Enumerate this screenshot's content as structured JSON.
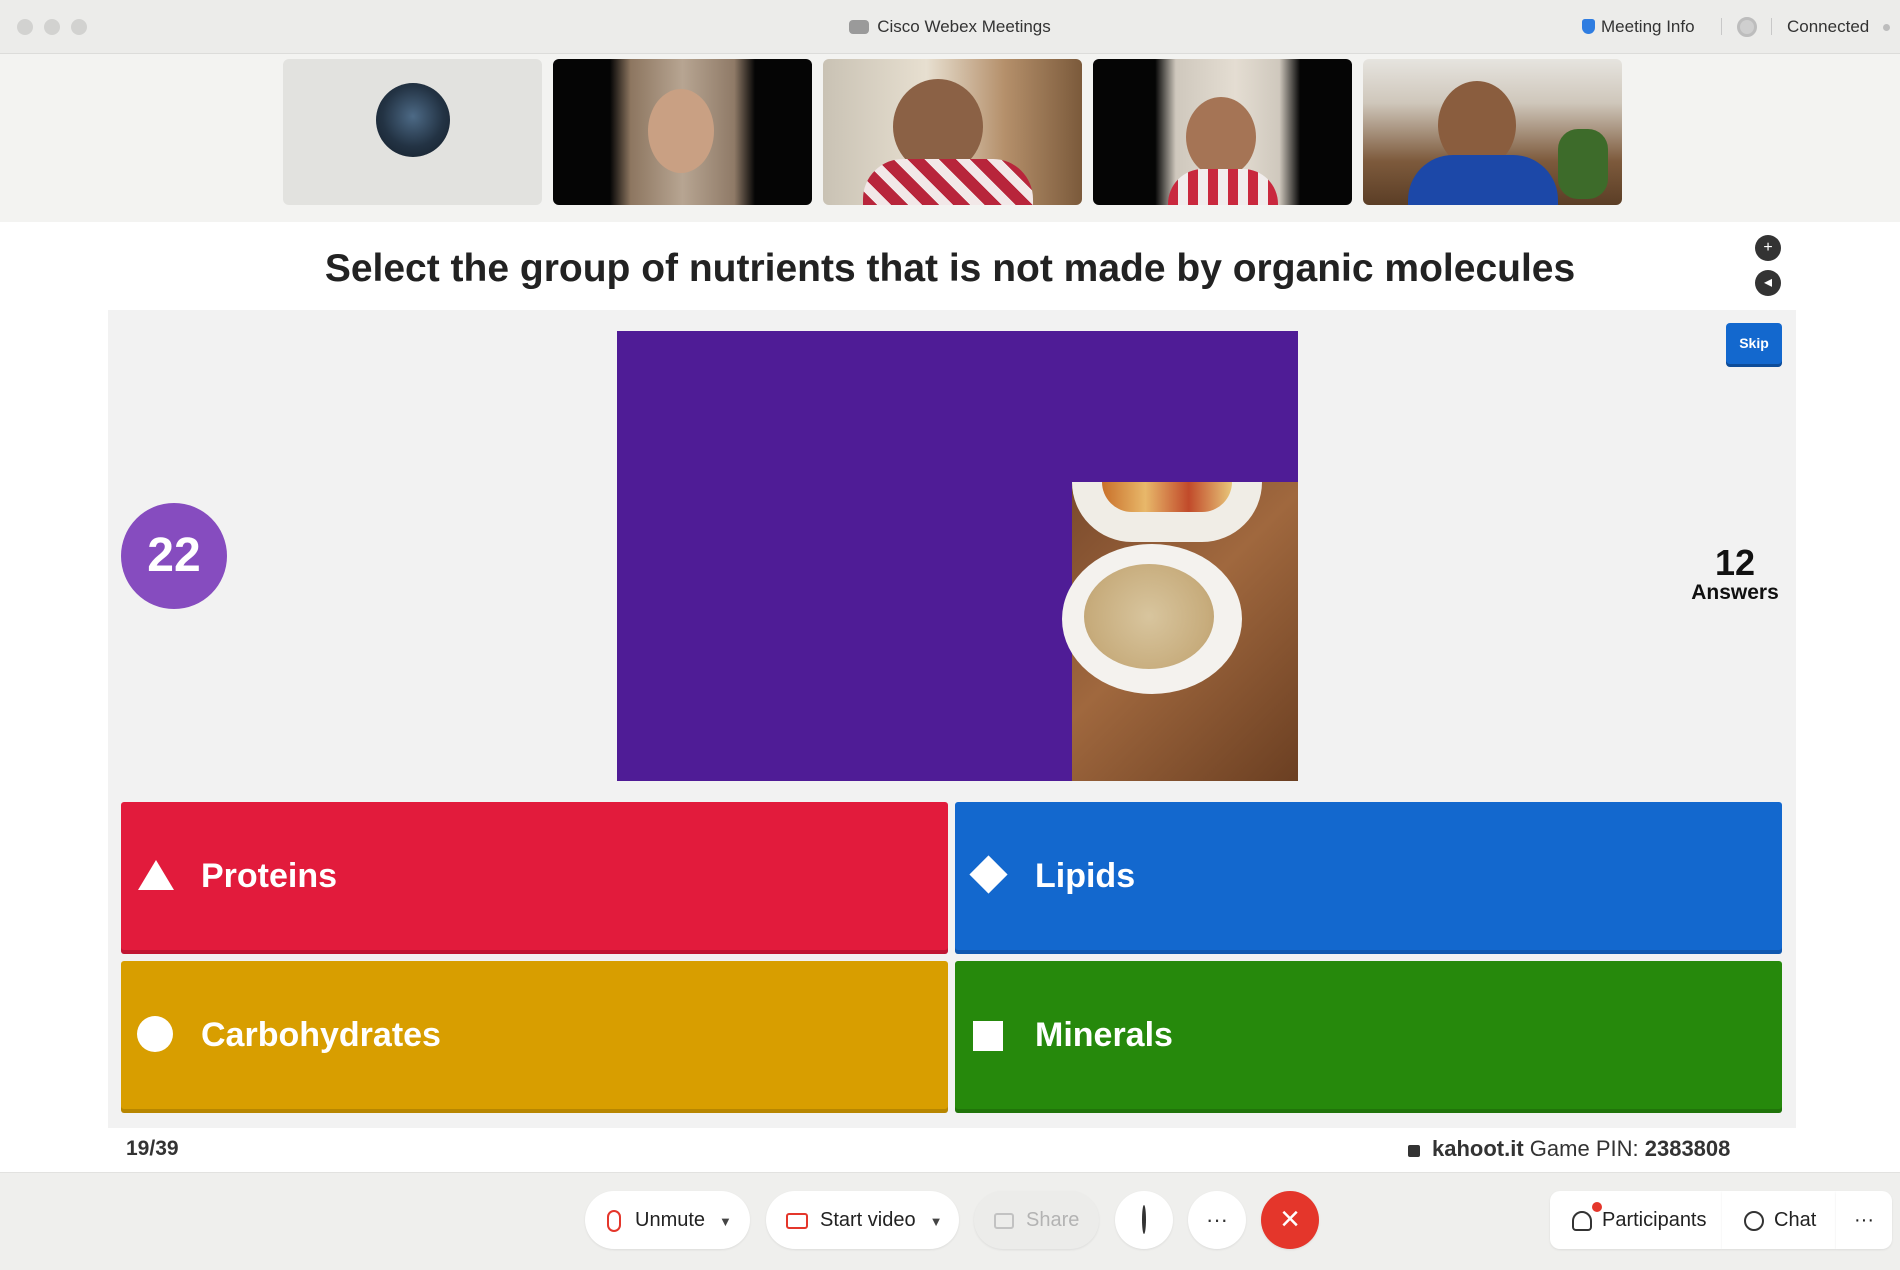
{
  "window": {
    "title": "Cisco Webex Meetings",
    "meeting_info": "Meeting Info",
    "status": "Connected"
  },
  "quiz": {
    "question": "Select the group of nutrients that is not made by organic molecules",
    "skip_label": "Skip",
    "timer": "22",
    "answers_count": "12",
    "answers_label": "Answers",
    "options": [
      {
        "label": "Proteins",
        "color": "#e21b3c",
        "shape": "triangle"
      },
      {
        "label": "Lipids",
        "color": "#1368ce",
        "shape": "diamond"
      },
      {
        "label": "Carbohydrates",
        "color": "#d89e00",
        "shape": "circle"
      },
      {
        "label": "Minerals",
        "color": "#26890c",
        "shape": "square"
      }
    ],
    "progress": "19/39",
    "site": "kahoot.it",
    "pin_label": "Game PIN:",
    "pin": "2383808"
  },
  "toolbar": {
    "unmute": "Unmute",
    "start_video": "Start video",
    "share": "Share",
    "participants": "Participants",
    "chat": "Chat",
    "more": "···"
  },
  "colors": {
    "media_bg": "#4f1c96",
    "timer_bg": "#864cbf",
    "skip_bg": "#1368ce",
    "end_call": "#e4362b"
  }
}
